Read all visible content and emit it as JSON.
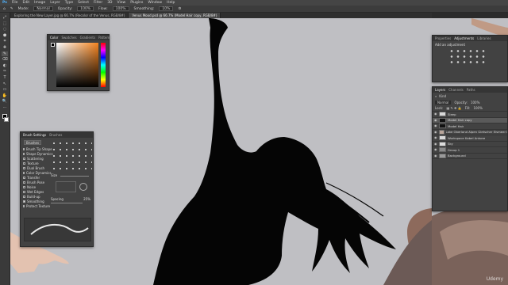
{
  "menu": [
    "Ps",
    "File",
    "Edit",
    "Image",
    "Layer",
    "Type",
    "Select",
    "Filter",
    "3D",
    "View",
    "Plugins",
    "Window",
    "Help"
  ],
  "options": {
    "mode_label": "Mode:",
    "mode_value": "Normal",
    "opacity_label": "Opacity:",
    "opacity_value": "100%",
    "flow_label": "Flow:",
    "flow_value": "100%",
    "smoothing_label": "Smoothing:",
    "smoothing_value": "10%"
  },
  "tabs": [
    {
      "label": "Exploring the New Layer.jpg @ 66.7% (Recolor of the Venus, RGB/8#)",
      "active": false
    },
    {
      "label": "Venus Mood.psd @ 66.7% (Model Hair copy, RGB/8#)",
      "active": true
    }
  ],
  "tools": [
    "⤢",
    "⬚",
    "◌",
    "⬢",
    "⌗",
    "✚",
    "✎",
    "⌫",
    "◐",
    "✑",
    "T",
    "↖",
    "▭",
    "✋",
    "🔍",
    "⋯"
  ],
  "color_panel": {
    "tabs": [
      "Color",
      "Swatches",
      "Gradients",
      "Patterns"
    ]
  },
  "brush_settings": {
    "tabs": [
      "Brush Settings",
      "Brushes"
    ],
    "brushes_button": "Brushes",
    "options": [
      {
        "label": "Brush Tip Shape",
        "checked": false
      },
      {
        "label": "Shape Dynamics",
        "checked": true
      },
      {
        "label": "Scattering",
        "checked": false
      },
      {
        "label": "Texture",
        "checked": false
      },
      {
        "label": "Dual Brush",
        "checked": false
      },
      {
        "label": "Color Dynamics",
        "checked": false
      },
      {
        "label": "Transfer",
        "checked": false
      },
      {
        "label": "Brush Pose",
        "checked": false
      },
      {
        "label": "Noise",
        "checked": false
      },
      {
        "label": "Wet Edges",
        "checked": false
      },
      {
        "label": "Build-up",
        "checked": false
      },
      {
        "label": "Smoothing",
        "checked": true
      },
      {
        "label": "Protect Texture",
        "checked": false
      }
    ],
    "size_label": "Size",
    "spacing_label": "Spacing",
    "spacing_value": "25%"
  },
  "properties_panel": {
    "tabs": [
      "Properties",
      "Adjustments",
      "Libraries"
    ],
    "title": "Add an adjustment"
  },
  "layers_panel": {
    "tabs": [
      "Layers",
      "Channels",
      "Paths"
    ],
    "kind_label": "Kind",
    "blend_mode": "Normal",
    "opacity_label": "Opacity:",
    "opacity_value": "100%",
    "lock_label": "Lock:",
    "fill_label": "Fill:",
    "fill_value": "100%",
    "layers": [
      {
        "name": "Sleep",
        "selected": false
      },
      {
        "name": "Model Hair copy",
        "selected": true
      },
      {
        "name": "Model Hair",
        "selected": false
      },
      {
        "name": "Lake Oberland Alpen Gletscher Eismeer Print AB-01.copy",
        "selected": false
      },
      {
        "name": "Workspace Kabel Antone",
        "selected": false
      },
      {
        "name": "Sky",
        "selected": false
      },
      {
        "name": "Group 1",
        "selected": false
      },
      {
        "name": "Background",
        "selected": false
      }
    ]
  },
  "watermark": "Udemy"
}
